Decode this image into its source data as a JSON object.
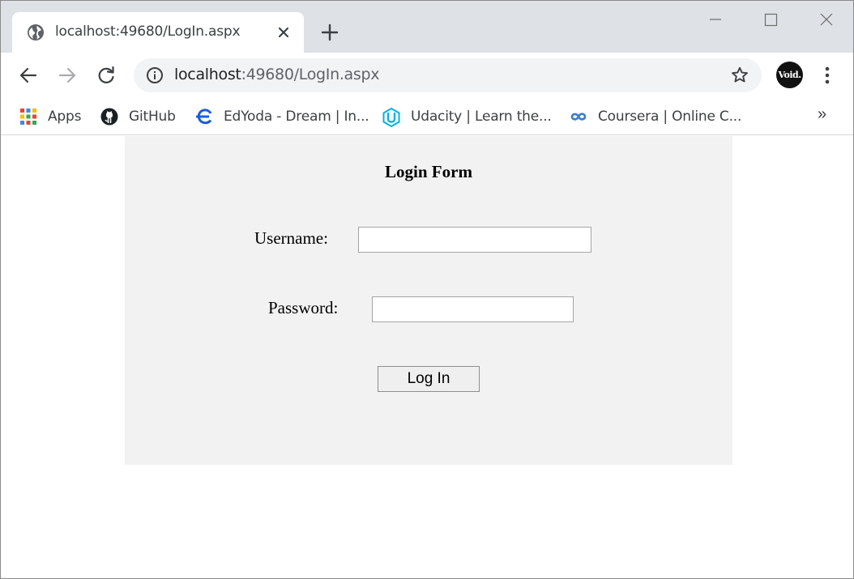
{
  "browser": {
    "tab": {
      "title": "localhost:49680/LogIn.aspx",
      "favicon": "globe-icon"
    },
    "address_bar": {
      "host": "localhost",
      "path": ":49680/LogIn.aspx"
    },
    "profile_label": "Void.",
    "bookmarks": [
      {
        "label": "Apps",
        "icon": "apps-grid-icon"
      },
      {
        "label": "GitHub",
        "icon": "github-icon"
      },
      {
        "label": "EdYoda - Dream | In...",
        "icon": "edyoda-icon"
      },
      {
        "label": "Udacity | Learn the...",
        "icon": "udacity-icon"
      },
      {
        "label": "Coursera | Online C...",
        "icon": "coursera-icon"
      }
    ],
    "bookmarks_more": "»"
  },
  "form": {
    "title": "Login Form",
    "username_label": "Username:",
    "username_value": "",
    "password_label": "Password:",
    "password_value": "",
    "submit_label": "Log In"
  },
  "colors": {
    "tabstrip_bg": "#dee1e6",
    "omnibox_bg": "#f1f3f4",
    "form_panel_bg": "#f2f2f2"
  }
}
